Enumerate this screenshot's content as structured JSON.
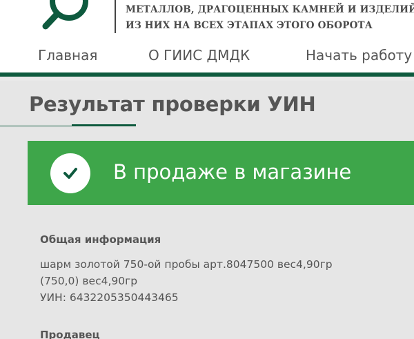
{
  "header": {
    "logo_icon": "magnifier-icon",
    "org_line_1": "МЕТАЛЛОВ, ДРАГОЦЕННЫХ КАМНЕЙ И ИЗДЕЛИЙ",
    "org_line_2": "ИЗ НИХ НА ВСЕХ ЭТАПАХ ЭТОГО ОБОРОТА"
  },
  "nav": {
    "items": [
      {
        "label": "Главная"
      },
      {
        "label": "О ГИИС ДМДК"
      },
      {
        "label": "Начать работу"
      }
    ]
  },
  "page": {
    "title": "Результат проверки УИН"
  },
  "status": {
    "icon": "checkmark-icon",
    "text": "В продаже в магазине",
    "color": "#3ea64a"
  },
  "general_info": {
    "heading": "Общая информация",
    "description_line_1": "шарм золотой 750-ой пробы арт.8047500 вес4,90гр",
    "description_line_2": "(750,0) вес4,90гр",
    "uin_line": "УИН: 6432205350443465"
  },
  "seller": {
    "heading": "Продавец"
  },
  "colors": {
    "brand_green": "#0e5a3e",
    "status_green": "#3ea64a",
    "text_gray": "#555555",
    "page_bg": "#e6e6e6"
  }
}
